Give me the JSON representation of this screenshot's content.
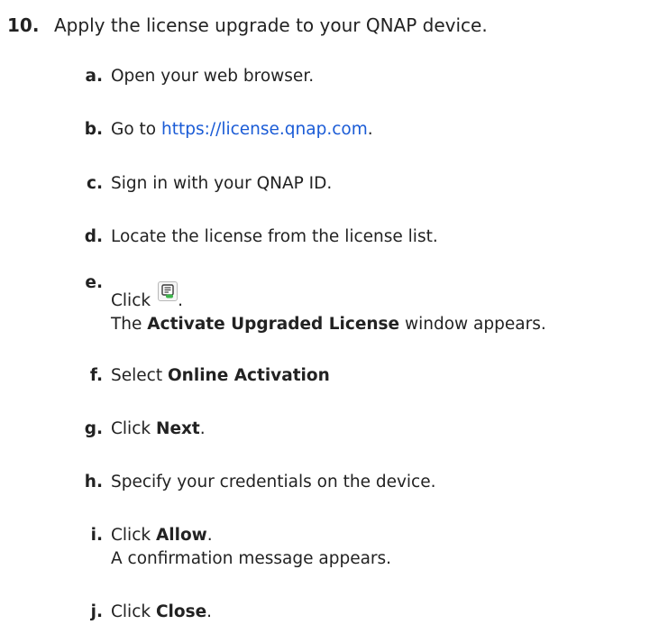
{
  "step": {
    "number": "10.",
    "text": "Apply the license upgrade to your QNAP device."
  },
  "substeps": [
    {
      "letter": "a.",
      "text": "Open your web browser."
    },
    {
      "letter": "b.",
      "prefix": "Go to ",
      "link": "https://license.qnap.com",
      "suffix": "."
    },
    {
      "letter": "c.",
      "text": "Sign in with your QNAP ID."
    },
    {
      "letter": "d.",
      "text": "Locate the license from the license list."
    },
    {
      "letter": "e.",
      "prefix": "Click",
      "suffix": ".",
      "icon": "license-activate-icon",
      "line2_bold": "Activate Upgraded License",
      "line2_rest": " window appears.",
      "line2_pre": "The "
    },
    {
      "letter": "f.",
      "prefix": "Select ",
      "bold": "Online Activation",
      "suffix": ""
    },
    {
      "letter": "g.",
      "prefix": "Click ",
      "bold": "Next",
      "suffix": "."
    },
    {
      "letter": "h.",
      "text": "Specify your credentials on the device."
    },
    {
      "letter": "i.",
      "prefix": "Click ",
      "bold": "Allow",
      "suffix": ".",
      "line2": "A confirmation message appears."
    },
    {
      "letter": "j.",
      "prefix": "Click ",
      "bold": "Close",
      "suffix": "."
    }
  ]
}
